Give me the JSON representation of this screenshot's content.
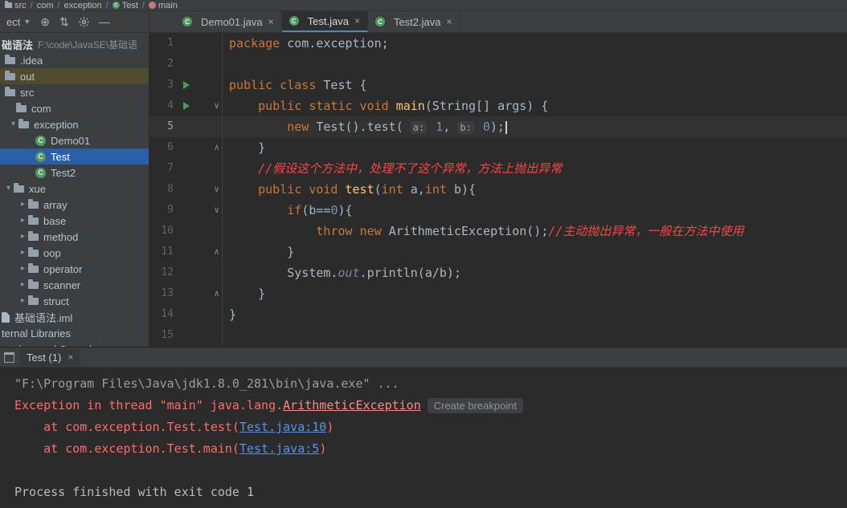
{
  "colors": {
    "window_chrome": "#3c3f41",
    "editor_bg": "#2b2b2b",
    "current_line": "#323232",
    "selection_blue": "#2d5fa8",
    "excluded_olive": "#504b2e",
    "tab_accent": "#4a88c7",
    "keyword": "#cc7832",
    "number": "#6897bb",
    "method_yellow": "#ffc66d",
    "field_purple": "#9876aa",
    "comment_red": "#fa4646",
    "error_red": "#ff6b68",
    "link_blue": "#5394ec",
    "run_green": "#499c54"
  },
  "navbar": {
    "items": [
      {
        "label": "src",
        "icon": "folder-icon"
      },
      {
        "label": "com"
      },
      {
        "label": "exception"
      },
      {
        "label": "Test",
        "icon": "class-icon"
      },
      {
        "label": "main",
        "icon": "method-icon"
      }
    ]
  },
  "project_panel": {
    "selector_label": "ect",
    "tools": [
      "locate-icon",
      "collapse-all-icon",
      "settings-icon",
      "hide-icon"
    ],
    "tool_glyphs": {
      "locate": "⊕",
      "collapse": "⇅",
      "hide": "—"
    },
    "tree": [
      {
        "label": "础语法",
        "path": "F:\\code\\JavaSE\\基础语",
        "icon": "none",
        "indent": 2,
        "bold": true
      },
      {
        "label": ".idea",
        "icon": "folder",
        "indent": 6
      },
      {
        "label": "out",
        "icon": "folder",
        "indent": 6,
        "highlight": true
      },
      {
        "label": "src",
        "icon": "folder",
        "indent": 6
      },
      {
        "label": "com",
        "icon": "folder",
        "indent": 20
      },
      {
        "label": "exception",
        "icon": "folder",
        "indent": 10,
        "chevron": "down"
      },
      {
        "label": "Demo01",
        "icon": "class",
        "indent": 44
      },
      {
        "label": "Test",
        "icon": "class",
        "indent": 44,
        "selected": true
      },
      {
        "label": "Test2",
        "icon": "class",
        "indent": 44
      },
      {
        "label": "xue",
        "icon": "folder",
        "indent": 4,
        "chevron": "down"
      },
      {
        "label": "array",
        "icon": "folder",
        "indent": 22,
        "chevron": "right"
      },
      {
        "label": "base",
        "icon": "folder",
        "indent": 22,
        "chevron": "right"
      },
      {
        "label": "method",
        "icon": "folder",
        "indent": 22,
        "chevron": "right"
      },
      {
        "label": "oop",
        "icon": "folder",
        "indent": 22,
        "chevron": "right"
      },
      {
        "label": "operator",
        "icon": "folder",
        "indent": 22,
        "chevron": "right"
      },
      {
        "label": "scanner",
        "icon": "folder",
        "indent": 22,
        "chevron": "right"
      },
      {
        "label": "struct",
        "icon": "folder",
        "indent": 22,
        "chevron": "right"
      },
      {
        "label": "基础语法.iml",
        "icon": "file",
        "indent": 2
      },
      {
        "label": "ternal Libraries",
        "icon": "none",
        "indent": 2
      },
      {
        "label": "ratches and Consoles",
        "icon": "none",
        "indent": 2
      }
    ]
  },
  "editor": {
    "tabs": [
      {
        "label": "Demo01.java",
        "close": "×"
      },
      {
        "label": "Test.java",
        "close": "×",
        "active": true
      },
      {
        "label": "Test2.java",
        "close": "×"
      }
    ],
    "lines": [
      {
        "num": 1,
        "segs": [
          [
            "kw",
            "package "
          ],
          [
            "pl",
            "com.exception;"
          ]
        ]
      },
      {
        "num": 2,
        "segs": []
      },
      {
        "num": 3,
        "run": true,
        "segs": [
          [
            "kw",
            "public class "
          ],
          [
            "pl",
            "Test {"
          ]
        ]
      },
      {
        "num": 4,
        "run": true,
        "fold": "open",
        "segs": [
          [
            "pl",
            "    "
          ],
          [
            "kw",
            "public static void "
          ],
          [
            "m",
            "main"
          ],
          [
            "pl",
            "(String[] args) {"
          ]
        ]
      },
      {
        "num": 5,
        "current": true,
        "caret": true,
        "segs": [
          [
            "pl",
            "        "
          ],
          [
            "kw",
            "new "
          ],
          [
            "pl",
            "Test().test( "
          ],
          [
            "inlay",
            "a:"
          ],
          [
            "n",
            " 1"
          ],
          [
            "pl",
            ", "
          ],
          [
            "inlay",
            "b:"
          ],
          [
            "n",
            " 0"
          ],
          [
            "pl",
            ");"
          ]
        ]
      },
      {
        "num": 6,
        "fold": "close",
        "segs": [
          [
            "pl",
            "    }"
          ]
        ]
      },
      {
        "num": 7,
        "segs": [
          [
            "pl",
            "    "
          ],
          [
            "c",
            "//假设这个方法中，处理不了这个异常，方法上抛出异常"
          ]
        ]
      },
      {
        "num": 8,
        "fold": "open",
        "segs": [
          [
            "pl",
            "    "
          ],
          [
            "kw",
            "public void "
          ],
          [
            "m",
            "test"
          ],
          [
            "pl",
            "("
          ],
          [
            "kw",
            "int"
          ],
          [
            "pl",
            " a,"
          ],
          [
            "kw",
            "int"
          ],
          [
            "pl",
            " b){"
          ]
        ]
      },
      {
        "num": 9,
        "fold": "open",
        "segs": [
          [
            "pl",
            "        "
          ],
          [
            "kw",
            "if"
          ],
          [
            "pl",
            "(b=="
          ],
          [
            "n",
            "0"
          ],
          [
            "pl",
            "){"
          ]
        ]
      },
      {
        "num": 10,
        "segs": [
          [
            "pl",
            "            "
          ],
          [
            "kw",
            "throw new "
          ],
          [
            "pl",
            "ArithmeticException();"
          ],
          [
            "c",
            "//主动抛出异常，一般在方法中使用"
          ]
        ]
      },
      {
        "num": 11,
        "fold": "close",
        "segs": [
          [
            "pl",
            "        }"
          ]
        ]
      },
      {
        "num": 12,
        "segs": [
          [
            "pl",
            "        System."
          ],
          [
            "f",
            "out"
          ],
          [
            "pl",
            ".println(a/b);"
          ]
        ]
      },
      {
        "num": 13,
        "fold": "close",
        "segs": [
          [
            "pl",
            "    }"
          ]
        ]
      },
      {
        "num": 14,
        "segs": [
          [
            "pl",
            "}"
          ]
        ]
      },
      {
        "num": 15,
        "segs": []
      }
    ]
  },
  "console": {
    "tab": {
      "label": "Test (1)",
      "close": "×",
      "icon": "run-console-icon"
    },
    "lines": [
      {
        "segs": [
          [
            "dim",
            "\"F:\\Program Files\\Java\\jdk1.8.0_281\\bin\\java.exe\" ..."
          ]
        ]
      },
      {
        "segs": [
          [
            "err",
            "Exception in thread \"main\" java.lang."
          ],
          [
            "errlnk",
            "ArithmeticException"
          ],
          [
            "badge",
            "Create breakpoint"
          ]
        ]
      },
      {
        "segs": [
          [
            "err",
            "    at com.exception.Test.test("
          ],
          [
            "lnk",
            "Test.java:10"
          ],
          [
            "err",
            ")"
          ]
        ]
      },
      {
        "segs": [
          [
            "err",
            "    at com.exception.Test.main("
          ],
          [
            "lnk",
            "Test.java:5"
          ],
          [
            "err",
            ")"
          ]
        ]
      },
      {
        "segs": []
      },
      {
        "segs": [
          [
            "con",
            "Process finished with exit code 1"
          ]
        ]
      }
    ]
  }
}
